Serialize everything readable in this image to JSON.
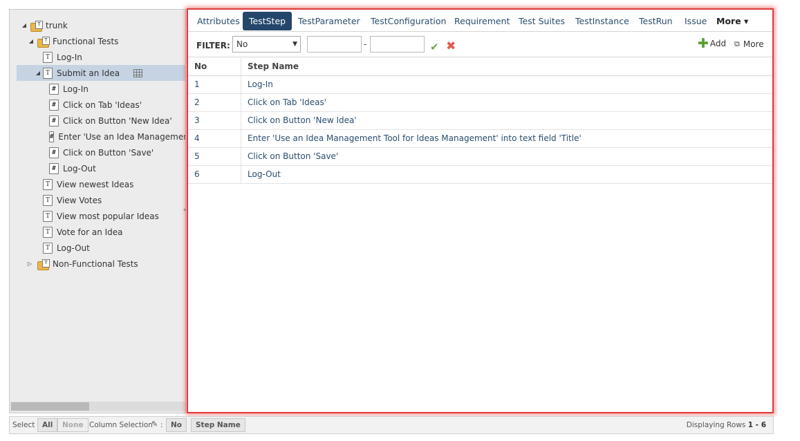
{
  "tree": {
    "items": [
      {
        "label": "trunk",
        "toggle": "◢",
        "icon": "folder-icon"
      },
      {
        "label": "Functional Tests",
        "toggle": "◢",
        "icon": "folder-icon"
      },
      {
        "label": "Log-In",
        "icon": "test-doc-icon"
      },
      {
        "label": "Submit an Idea",
        "toggle": "◢",
        "icon": "test-doc-icon"
      },
      {
        "label": "Log-In",
        "icon": "step-doc-icon"
      },
      {
        "label": "Click on Tab 'Ideas'",
        "icon": "step-doc-icon"
      },
      {
        "label": "Click on Button 'New Idea'",
        "icon": "step-doc-icon"
      },
      {
        "label": "Enter 'Use an Idea Management Tool for Ideas Management' into text field 'Title'",
        "icon": "step-doc-icon"
      },
      {
        "label": "Click on Button 'Save'",
        "icon": "step-doc-icon"
      },
      {
        "label": "Log-Out",
        "icon": "step-doc-icon"
      },
      {
        "label": "View newest Ideas",
        "icon": "test-doc-icon"
      },
      {
        "label": "View Votes",
        "icon": "test-doc-icon"
      },
      {
        "label": "View most popular Ideas",
        "icon": "test-doc-icon"
      },
      {
        "label": "Vote for an Idea",
        "icon": "test-doc-icon"
      },
      {
        "label": "Log-Out",
        "icon": "test-doc-icon"
      },
      {
        "label": "Non-Functional Tests",
        "toggle": "▷",
        "icon": "folder-icon"
      }
    ]
  },
  "tabs": [
    {
      "label": "Attributes"
    },
    {
      "label": "TestStep",
      "active": true
    },
    {
      "label": "TestParameter"
    },
    {
      "label": "TestConfiguration"
    },
    {
      "label": "Requirement"
    },
    {
      "label": "Test Suites"
    },
    {
      "label": "TestInstance"
    },
    {
      "label": "TestRun"
    },
    {
      "label": "Issue"
    },
    {
      "label": "More ▾"
    }
  ],
  "filter": {
    "label": "FILTER:",
    "select_value": "No",
    "range_from": "",
    "range_to": "",
    "dash": "-"
  },
  "toolbar": {
    "add_label": "Add",
    "more_label": "More"
  },
  "grid": {
    "columns": [
      "No",
      "Step Name"
    ],
    "rows": [
      {
        "no": "1",
        "name": "Log-In"
      },
      {
        "no": "2",
        "name": "Click on Tab 'Ideas'"
      },
      {
        "no": "3",
        "name": "Click on Button 'New Idea'"
      },
      {
        "no": "4",
        "name": "Enter 'Use an Idea Management Tool for Ideas Management' into text field 'Title'"
      },
      {
        "no": "5",
        "name": "Click on Button 'Save'"
      },
      {
        "no": "6",
        "name": "Log-Out"
      }
    ]
  },
  "footer": {
    "select_label": "Select",
    "all_label": "All",
    "none_label": "None",
    "column_selection_label": "Column Selection",
    "colon": ":",
    "col_no": "No",
    "col_step_name": "Step Name",
    "displaying_label": "Displaying Rows",
    "rows_range": "1 - 6"
  },
  "colors": {
    "active_tab": "#24466b",
    "highlight_border": "#e03a3a",
    "selected_tree_row": "#c5d3e3"
  }
}
